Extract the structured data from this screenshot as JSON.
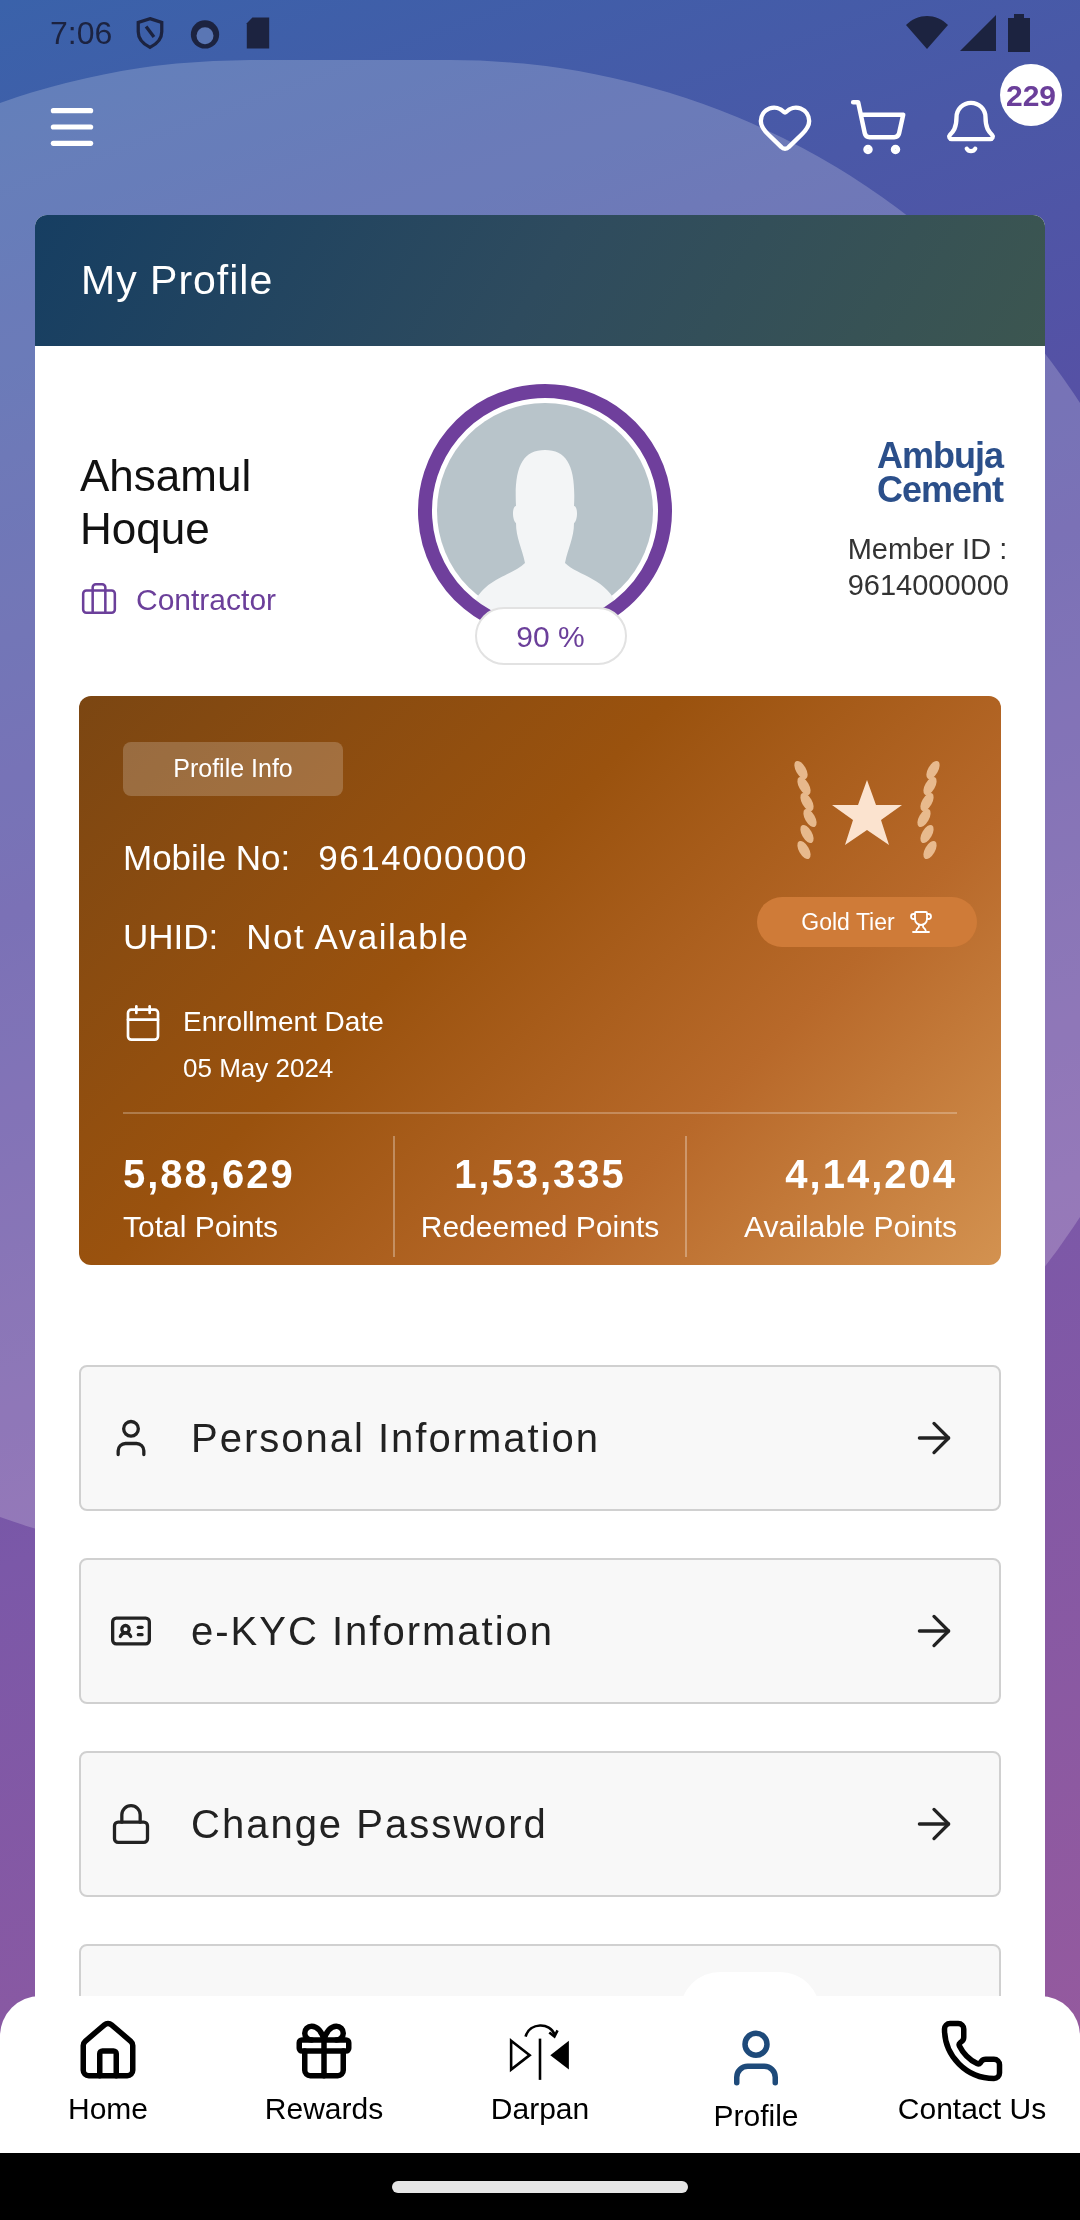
{
  "status_bar": {
    "time": "7:06"
  },
  "app_bar": {
    "notification_count": "229"
  },
  "page": {
    "title": "My Profile"
  },
  "profile": {
    "name": "Ahsamul Hoque",
    "role": "Contractor",
    "completion": {
      "level": 0.9,
      "label": "90 %"
    },
    "brand": [
      "Ambuja",
      "Cement"
    ],
    "member_id_label": "Member ID :",
    "member_id": "9614000000"
  },
  "info_card": {
    "tag": "Profile Info",
    "fields": [
      {
        "label": "Mobile No:",
        "value": "9614000000"
      },
      {
        "label": "UHID:",
        "value": "Not Available"
      }
    ],
    "enrollment": {
      "label": "Enrollment Date",
      "value": "05 May 2024"
    },
    "tier": "Gold Tier",
    "points": [
      {
        "value": "5,88,629",
        "label": "Total Points"
      },
      {
        "value": "1,53,335",
        "label": "Redeemed Points"
      },
      {
        "value": "4,14,204",
        "label": "Available Points"
      }
    ]
  },
  "menu": [
    {
      "kind": "person",
      "label": "Personal Information"
    },
    {
      "kind": "id-card",
      "label": "e-KYC Information"
    },
    {
      "kind": "lock",
      "label": "Change Password"
    }
  ],
  "nav": [
    {
      "kind": "home",
      "label": "Home",
      "selected": false
    },
    {
      "kind": "gift",
      "label": "Rewards",
      "selected": false
    },
    {
      "kind": "darpan",
      "label": "Darpan",
      "selected": false
    },
    {
      "kind": "person",
      "label": "Profile",
      "selected": true
    },
    {
      "kind": "phone",
      "label": "Contact Us",
      "selected": false
    }
  ]
}
